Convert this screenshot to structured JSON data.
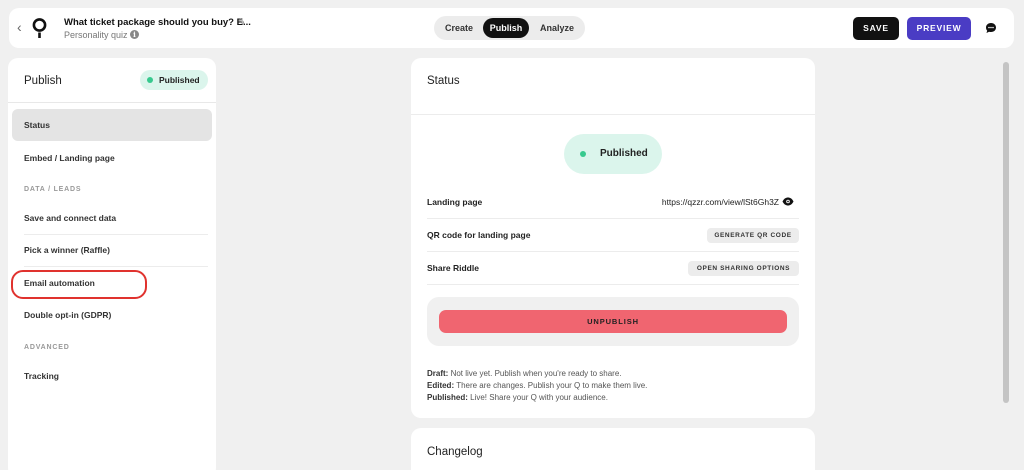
{
  "header": {
    "back_icon": "chevron-left-icon",
    "title": "What ticket package should you buy? E...",
    "subtitle": "Personality quiz",
    "tabs": [
      {
        "label": "Create",
        "active": false
      },
      {
        "label": "Publish",
        "active": true
      },
      {
        "label": "Analyze",
        "active": false
      }
    ],
    "save_label": "SAVE",
    "preview_label": "PREVIEW",
    "accent_color": "#4a3cc4"
  },
  "sidebar": {
    "title": "Publish",
    "badge": "Published",
    "items": [
      {
        "label": "Status",
        "active": true
      },
      {
        "label": "Embed / Landing page"
      },
      {
        "section": "DATA / LEADS"
      },
      {
        "label": "Save and connect data"
      },
      {
        "label": "Pick a winner (Raffle)"
      },
      {
        "label": "Email automation",
        "highlighted": true
      },
      {
        "label": "Double opt-in (GDPR)"
      },
      {
        "section": "ADVANCED"
      },
      {
        "label": "Tracking"
      }
    ]
  },
  "status_card": {
    "title": "Status",
    "status_pill": "Published",
    "status_color": "#37c98e",
    "landing_page_label": "Landing page",
    "landing_page_url": "https://qzzr.com/view/lSt6Gh3Z",
    "qr_label": "QR code for landing page",
    "qr_button": "GENERATE QR CODE",
    "share_label": "Share Riddle",
    "share_button": "OPEN SHARING OPTIONS",
    "unpublish_button": "UNPUBLISH",
    "unpublish_color": "#f06570",
    "legend": [
      {
        "term": "Draft:",
        "text": " Not live yet. Publish when you're ready to share."
      },
      {
        "term": "Edited:",
        "text": " There are changes. Publish your Q to make them live."
      },
      {
        "term": "Published:",
        "text": " Live! Share your Q with your audience."
      }
    ]
  },
  "changelog_card": {
    "title": "Changelog"
  }
}
